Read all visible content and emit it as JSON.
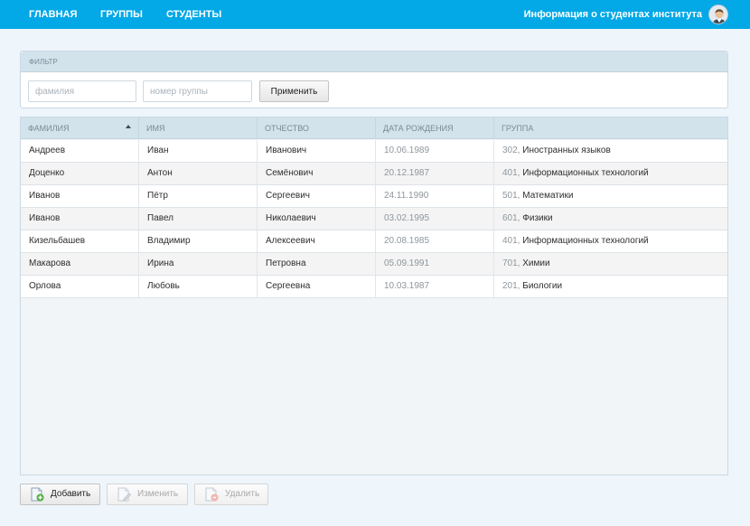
{
  "nav": {
    "items": [
      "ГЛАВНАЯ",
      "ГРУППЫ",
      "СТУДЕНТЫ"
    ],
    "app_title": "Информация о студентах института"
  },
  "filter": {
    "title": "ФИЛЬТР",
    "surname_placeholder": "фамилия",
    "surname_value": "",
    "group_placeholder": "номер группы",
    "group_value": "",
    "apply_label": "Применить"
  },
  "grid": {
    "columns": [
      "ФАМИЛИЯ",
      "ИМЯ",
      "ОТЧЕСТВО",
      "ДАТА РОЖДЕНИЯ",
      "ГРУППА"
    ],
    "sorted_column": "ФАМИЛИЯ",
    "sort_direction": "ascending",
    "rows": [
      {
        "surname": "Андреев",
        "name": "Иван",
        "patronymic": "Иванович",
        "birth": "10.06.1989",
        "group_num": "302,",
        "group_name": "Иностранных языков"
      },
      {
        "surname": "Доценко",
        "name": "Антон",
        "patronymic": "Семёнович",
        "birth": "20.12.1987",
        "group_num": "401,",
        "group_name": "Информационных технологий"
      },
      {
        "surname": "Иванов",
        "name": "Пётр",
        "patronymic": "Сергеевич",
        "birth": "24.11.1990",
        "group_num": "501,",
        "group_name": "Математики"
      },
      {
        "surname": "Иванов",
        "name": "Павел",
        "patronymic": "Николаевич",
        "birth": "03.02.1995",
        "group_num": "601,",
        "group_name": "Физики"
      },
      {
        "surname": "Кизельбашев",
        "name": "Владимир",
        "patronymic": "Алексеевич",
        "birth": "20.08.1985",
        "group_num": "401,",
        "group_name": "Информационных технологий"
      },
      {
        "surname": "Макарова",
        "name": "Ирина",
        "patronymic": "Петровна",
        "birth": "05.09.1991",
        "group_num": "701,",
        "group_name": "Химии"
      },
      {
        "surname": "Орлова",
        "name": "Любовь",
        "patronymic": "Сергеевна",
        "birth": "10.03.1987",
        "group_num": "201,",
        "group_name": "Биологии"
      }
    ]
  },
  "actions": {
    "add_label": "Добавить",
    "edit_label": "Изменить",
    "delete_label": "Удалить"
  },
  "icons": {
    "avatar": "user-avatar-icon",
    "add": "add-document-icon",
    "edit": "edit-document-icon",
    "delete": "delete-document-icon",
    "sort": "sort-ascending-icon"
  },
  "colors": {
    "topbar": "#03a8e6",
    "header_bg": "#d3e3ec",
    "page_bg": "#eef5fb"
  }
}
